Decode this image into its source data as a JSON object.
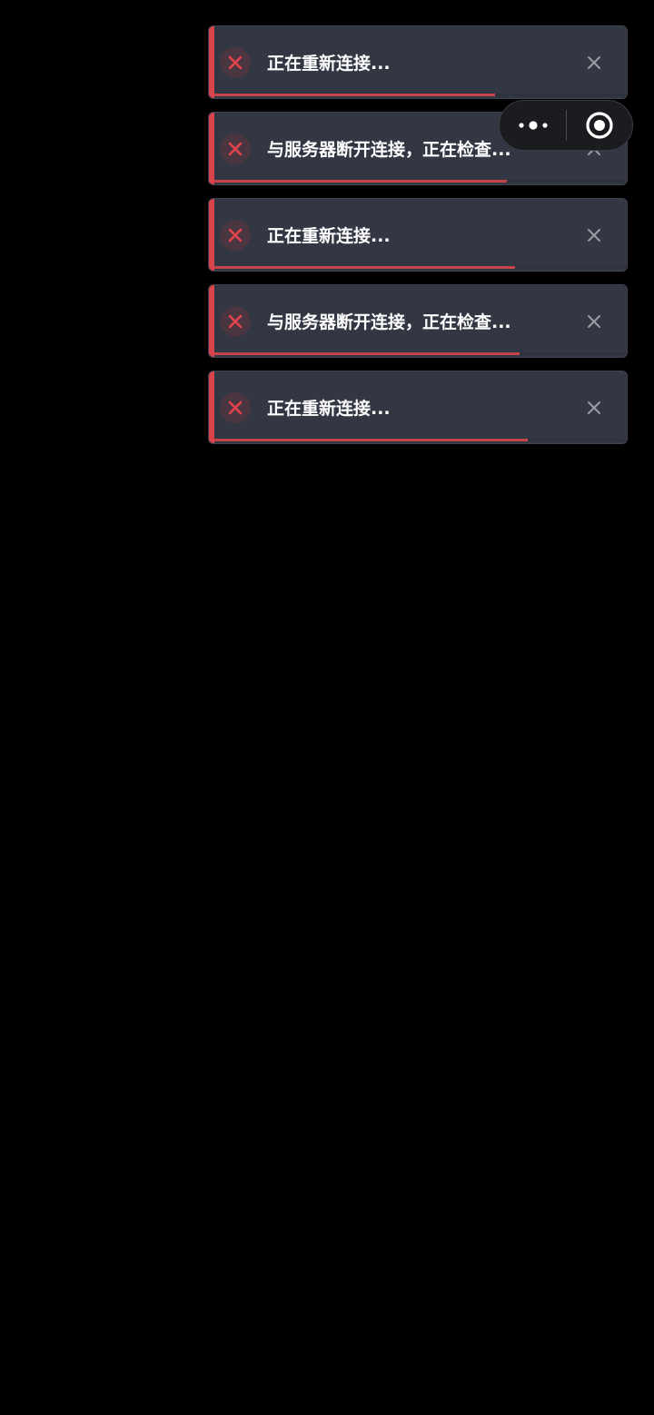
{
  "toasts": [
    {
      "message": "正在重新连接...",
      "progress": 0.68,
      "icon": "error-x-icon",
      "close_icon": "close-icon"
    },
    {
      "message": "与服务器断开连接，正在检查...",
      "progress": 0.71,
      "icon": "error-x-icon",
      "close_icon": "close-icon"
    },
    {
      "message": "正在重新连接...",
      "progress": 0.73,
      "icon": "error-x-icon",
      "close_icon": "close-icon"
    },
    {
      "message": "与服务器断开连接，正在检查...",
      "progress": 0.74,
      "icon": "error-x-icon",
      "close_icon": "close-icon"
    },
    {
      "message": "正在重新连接...",
      "progress": 0.76,
      "icon": "error-x-icon",
      "close_icon": "close-icon"
    }
  ],
  "capsule": {
    "more_icon": "more-dots-icon",
    "target_icon": "target-circle-icon"
  },
  "colors": {
    "background": "#000000",
    "toast_bg": "#333744",
    "accent_error": "#d9434b",
    "text": "#ffffff",
    "close": "#9a9ca4"
  }
}
